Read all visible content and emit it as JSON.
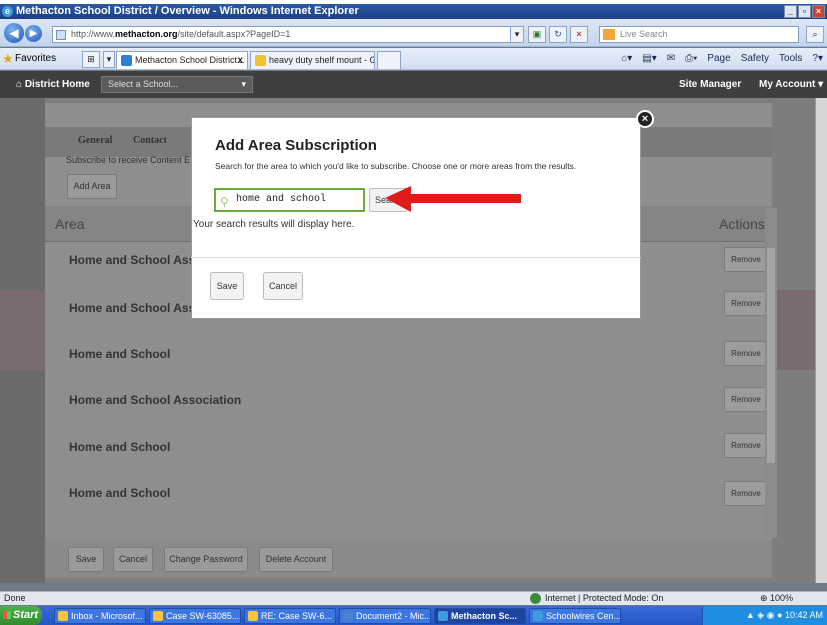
{
  "browser": {
    "window_title": "Methacton School District / Overview - Windows Internet Explorer",
    "url_prefix": "http://www.",
    "url_domain": "methacton.org",
    "url_path": "/site/default.aspx?PageID=1",
    "search_placeholder": "Live Search",
    "favorites_label": "Favorites",
    "tabs": [
      {
        "label": "Methacton School District...",
        "close": "x"
      },
      {
        "label": "heavy duty shelf mount - Go..."
      }
    ],
    "commands": [
      "Page",
      "Safety",
      "Tools"
    ]
  },
  "site_nav": {
    "home": "District Home",
    "select_school": "Select a School...",
    "site_manager": "Site Manager",
    "my_account": "My Account"
  },
  "page": {
    "tabs": [
      "General",
      "Contact"
    ],
    "subscribe_text": "Subscribe to receive Content E...",
    "add_area_button": "Add Area",
    "columns": {
      "area": "Area",
      "actions": "Actions"
    },
    "rows": [
      {
        "title": "Home and School Ass",
        "action": "Remove"
      },
      {
        "title": "Home and School Ass",
        "action": "Remove"
      },
      {
        "title": "Home and School",
        "action": "Remove"
      },
      {
        "title": "Home and School Association",
        "action": "Remove"
      },
      {
        "title": "Home and School",
        "action": "Remove"
      },
      {
        "title": "Home and School",
        "action": "Remove"
      }
    ],
    "footer_buttons": [
      "Save",
      "Cancel",
      "Change Password",
      "Delete Account"
    ]
  },
  "modal": {
    "title": "Add Area Subscription",
    "subtitle": "Search for the area to which you'd like to subscribe. Choose one or more areas from the results.",
    "search_value": "home and school",
    "search_button": "Search",
    "results_message": "Your search results will display here.",
    "save": "Save",
    "cancel": "Cancel"
  },
  "statusbar": {
    "status": "Done",
    "zone": "Internet | Protected Mode: On",
    "zoom": "100%"
  },
  "taskbar": {
    "start": "Start",
    "items": [
      "Inbox - Microsof...",
      "Case SW-63085...",
      "RE: Case SW-6...",
      "Document2 - Mic...",
      "Methacton Sc...",
      "Schoolwires Cen..."
    ],
    "clock": "10:42 AM"
  },
  "colors": {
    "accent_green": "#6aab3c",
    "arrow_red": "#e01b1b",
    "nav_bg": "#3f3f3f"
  }
}
